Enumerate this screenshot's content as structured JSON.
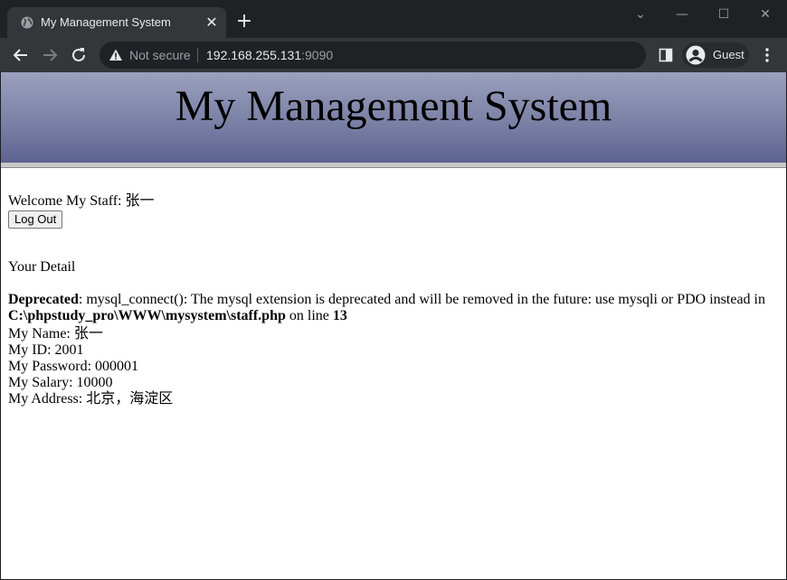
{
  "browser": {
    "tab_title": "My Management System",
    "tab_close": "✕",
    "new_tab": "+",
    "not_secure": "Not secure",
    "url_host": "192.168.255.131",
    "url_port": ":9090",
    "profile_label": "Guest",
    "window_controls": {
      "dropdown": "⌄",
      "minimize": "—",
      "maximize": "☐",
      "close": "✕"
    }
  },
  "page": {
    "site_title": "My Management System",
    "welcome": "Welcome My Staff: 张一",
    "logout_label": "Log Out",
    "detail_heading": "Your Detail",
    "warning": {
      "prefix": "Deprecated",
      "message": ": mysql_connect(): The mysql extension is deprecated and will be removed in the future: use mysqli or PDO instead in ",
      "path": "C:\\phpstudy_pro\\WWW\\mysystem\\staff.php",
      "on_line": " on line ",
      "line_number": "13"
    },
    "fields": [
      "My Name: 张一",
      "My ID: 2001",
      "My Password: 000001",
      "My Salary: 10000",
      "My Address: 北京，海淀区"
    ]
  },
  "colors": {
    "chrome_dark": "#202124",
    "chrome_toolbar": "#35363a",
    "header_gradient_top": "#9ba0bd",
    "header_gradient_bottom": "#5d6390"
  }
}
